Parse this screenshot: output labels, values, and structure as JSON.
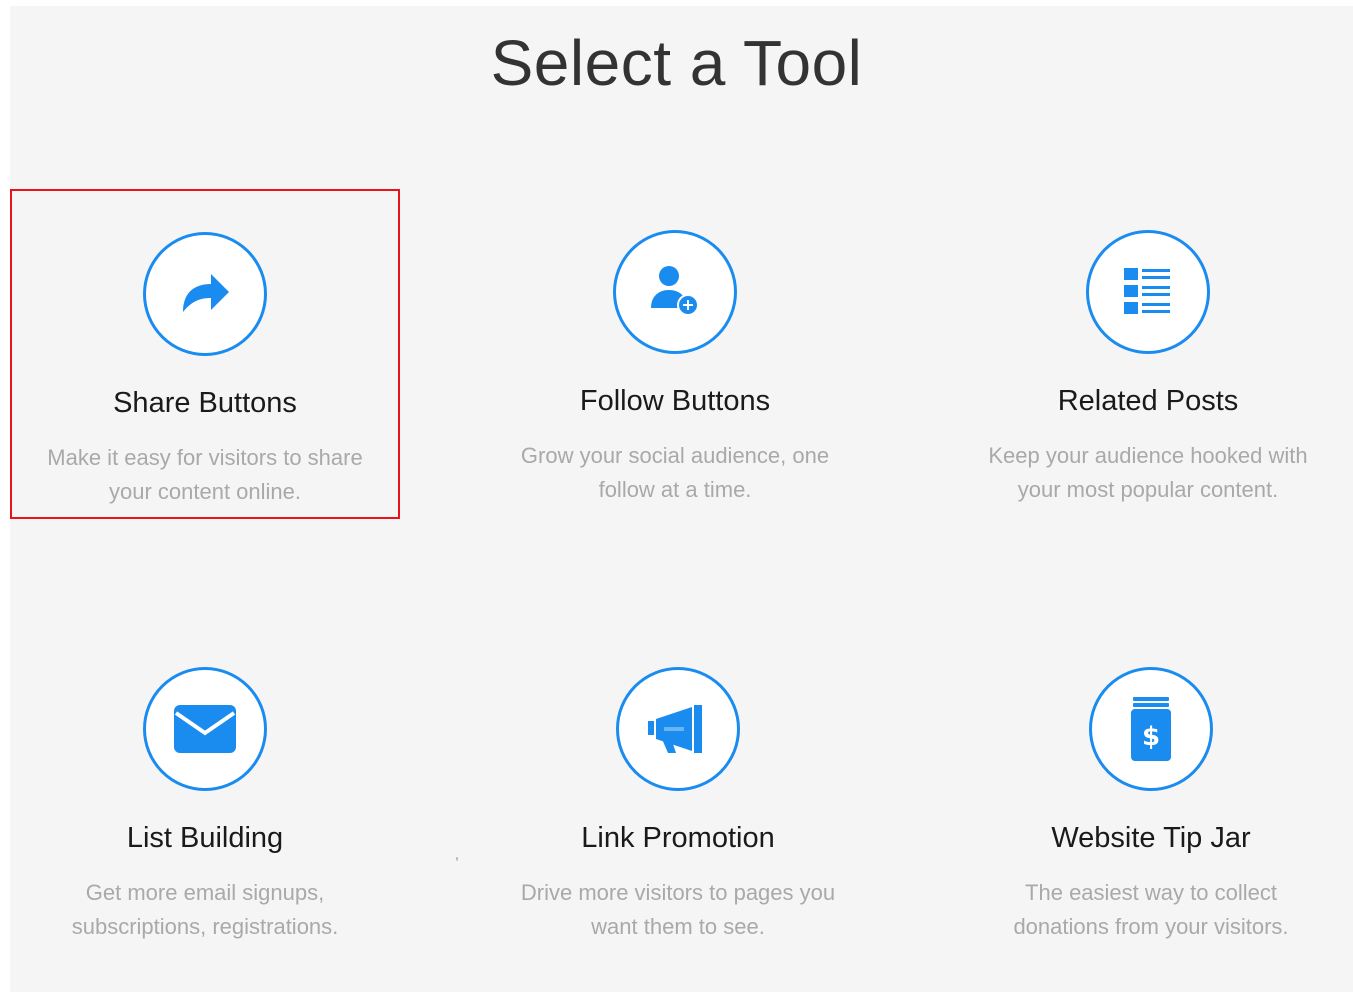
{
  "title": "Select a Tool",
  "accent_color": "#1a8cf0",
  "selection_color": "#e8141c",
  "tools": [
    {
      "name": "Share Buttons",
      "description": "Make it easy for visitors to share your content online.",
      "icon": "share-arrow-icon",
      "selected": true
    },
    {
      "name": "Follow Buttons",
      "description": "Grow your social audience, one follow at a time.",
      "icon": "add-user-icon",
      "selected": false
    },
    {
      "name": "Related Posts",
      "description": "Keep your audience hooked with your most popular content.",
      "icon": "list-icon",
      "selected": false
    },
    {
      "name": "List Building",
      "description": "Get more email signups, subscriptions, registrations.",
      "icon": "envelope-icon",
      "selected": false
    },
    {
      "name": "Link Promotion",
      "description": "Drive more visitors to pages you want them to see.",
      "icon": "megaphone-icon",
      "selected": false
    },
    {
      "name": "Website Tip Jar",
      "description": "The easiest way to collect donations from your visitors.",
      "icon": "tip-jar-icon",
      "selected": false
    }
  ]
}
